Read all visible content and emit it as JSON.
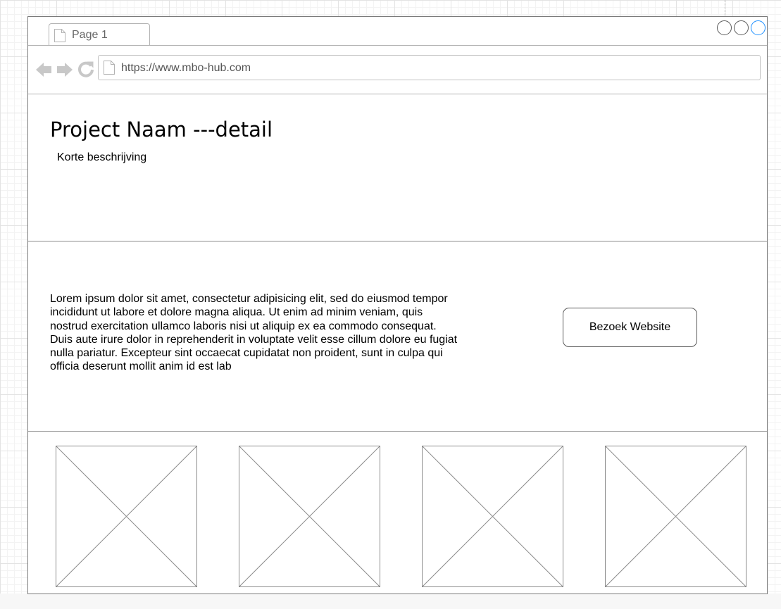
{
  "browser": {
    "tab_label": "Page 1",
    "url": "https://www.mbo-hub.com"
  },
  "icons": {
    "tab": "page-icon",
    "back": "arrow-left-icon",
    "forward": "arrow-right-icon",
    "reload": "reload-icon",
    "address": "page-icon",
    "placeholder": "image-placeholder-icon"
  },
  "header": {
    "title": "Project Naam ---detail",
    "subtitle": "Korte beschrijving"
  },
  "main": {
    "description": "Lorem ipsum dolor sit amet, consectetur adipisicing elit, sed do eiusmod tempor incididunt ut labore et dolore magna aliqua. Ut enim ad minim veniam, quis nostrud exercitation ullamco laboris nisi ut aliquip ex ea commodo consequat. Duis aute irure dolor in reprehenderit in voluptate velit esse cillum dolore eu fugiat nulla pariatur. Excepteur sint occaecat cupidatat non proident, sunt in culpa qui officia deserunt mollit anim id est lab",
    "visit_button": "Bezoek Website"
  },
  "colors": {
    "window_border": "#7a7a7a",
    "divider": "#8c8c8c",
    "nav_icon": "#c8c8c8",
    "close_accent": "#1e90ff"
  }
}
